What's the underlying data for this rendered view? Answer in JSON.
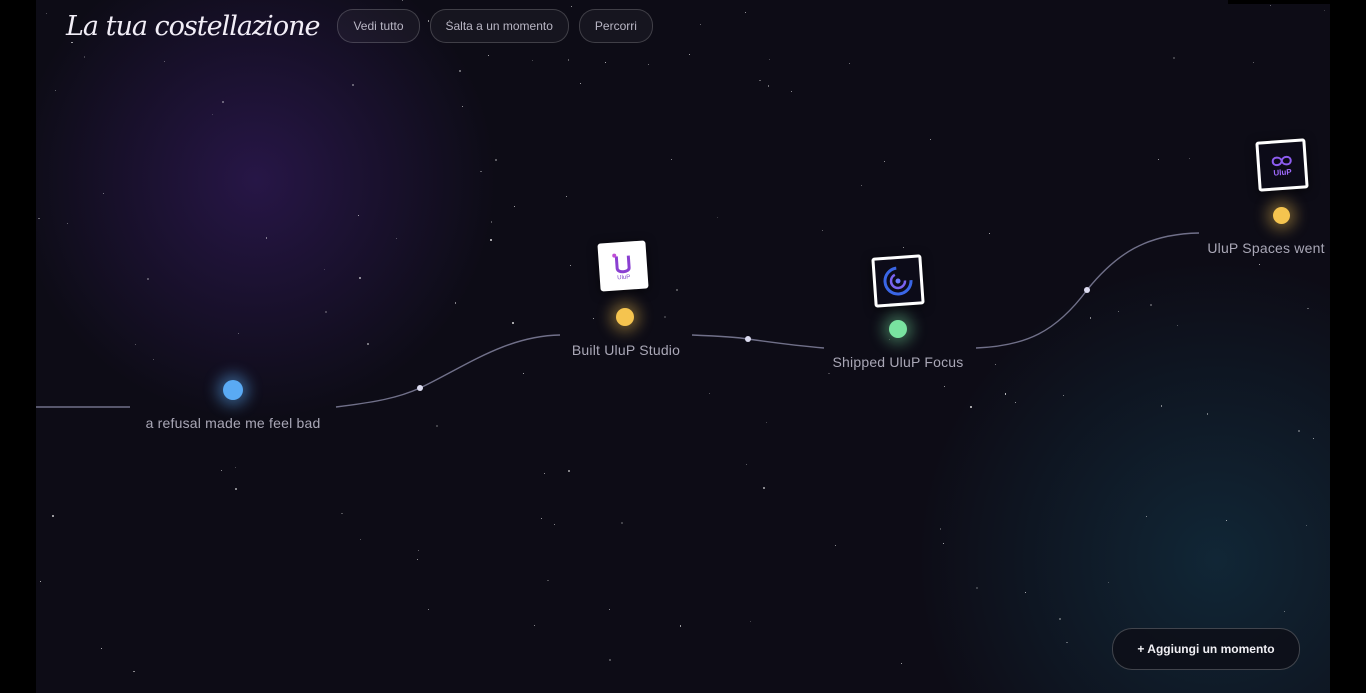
{
  "header": {
    "title": "La tua costellazione",
    "buttons": [
      "Vedi tutto",
      "Salta a un momento",
      "Percorri"
    ]
  },
  "moments": [
    {
      "label": "a refusal made me feel bad",
      "color": "#5aaaf4"
    },
    {
      "label": "Built UluP Studio",
      "color": "#f5c44f",
      "logo": "U",
      "logo_sub": "UluP"
    },
    {
      "label": "Shipped UluP Focus",
      "color": "#79e3a0",
      "logo": "focus-ring-icon"
    },
    {
      "label": "UluP Spaces went",
      "color": "#f5c44f",
      "logo": "UluP"
    }
  ],
  "fab": {
    "label": "+ Aggiungi un momento"
  },
  "colors": {
    "background": "#0d0c16",
    "path": "#8a8aa6"
  }
}
